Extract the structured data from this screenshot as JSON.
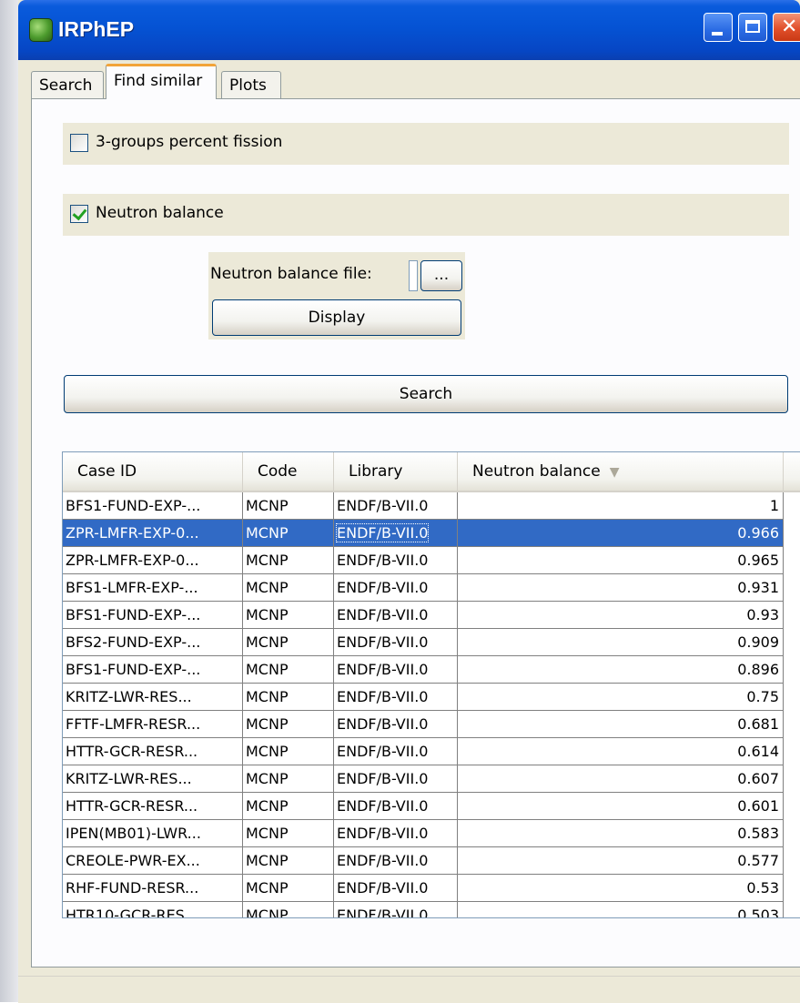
{
  "window": {
    "title": "IRPhEP"
  },
  "tabs": [
    {
      "label": "Search",
      "active": false
    },
    {
      "label": "Find similar",
      "active": true
    },
    {
      "label": "Plots",
      "active": false
    }
  ],
  "options": {
    "percent_fission": {
      "label": "3-groups percent fission",
      "checked": false
    },
    "neutron_balance": {
      "label": "Neutron balance",
      "checked": true
    }
  },
  "neutron_balance_file": {
    "label": "Neutron balance file:",
    "value": "",
    "browse_label": "...",
    "display_label": "Display"
  },
  "search_button_label": "Search",
  "table": {
    "columns": [
      "Case ID",
      "Code",
      "Library",
      "Neutron balance"
    ],
    "sort_column": "Neutron balance",
    "sort_direction": "descending",
    "rows": [
      {
        "case_id": "BFS1-FUND-EXP-...",
        "code": "MCNP",
        "library": "ENDF/B-VII.0",
        "balance": "1",
        "selected": false
      },
      {
        "case_id": "ZPR-LMFR-EXP-0...",
        "code": "MCNP",
        "library": "ENDF/B-VII.0",
        "balance": "0.966",
        "selected": true
      },
      {
        "case_id": "ZPR-LMFR-EXP-0...",
        "code": "MCNP",
        "library": "ENDF/B-VII.0",
        "balance": "0.965",
        "selected": false
      },
      {
        "case_id": "BFS1-LMFR-EXP-...",
        "code": "MCNP",
        "library": "ENDF/B-VII.0",
        "balance": "0.931",
        "selected": false
      },
      {
        "case_id": "BFS1-FUND-EXP-...",
        "code": "MCNP",
        "library": "ENDF/B-VII.0",
        "balance": "0.93",
        "selected": false
      },
      {
        "case_id": "BFS2-FUND-EXP-...",
        "code": "MCNP",
        "library": "ENDF/B-VII.0",
        "balance": "0.909",
        "selected": false
      },
      {
        "case_id": "BFS1-FUND-EXP-...",
        "code": "MCNP",
        "library": "ENDF/B-VII.0",
        "balance": "0.896",
        "selected": false
      },
      {
        "case_id": "KRITZ-LWR-RES...",
        "code": "MCNP",
        "library": "ENDF/B-VII.0",
        "balance": "0.75",
        "selected": false
      },
      {
        "case_id": "FFTF-LMFR-RESR...",
        "code": "MCNP",
        "library": "ENDF/B-VII.0",
        "balance": "0.681",
        "selected": false
      },
      {
        "case_id": "HTTR-GCR-RESR...",
        "code": "MCNP",
        "library": "ENDF/B-VII.0",
        "balance": "0.614",
        "selected": false
      },
      {
        "case_id": "KRITZ-LWR-RES...",
        "code": "MCNP",
        "library": "ENDF/B-VII.0",
        "balance": "0.607",
        "selected": false
      },
      {
        "case_id": "HTTR-GCR-RESR...",
        "code": "MCNP",
        "library": "ENDF/B-VII.0",
        "balance": "0.601",
        "selected": false
      },
      {
        "case_id": "IPEN(MB01)-LWR...",
        "code": "MCNP",
        "library": "ENDF/B-VII.0",
        "balance": "0.583",
        "selected": false
      },
      {
        "case_id": "CREOLE-PWR-EX...",
        "code": "MCNP",
        "library": "ENDF/B-VII.0",
        "balance": "0.577",
        "selected": false
      },
      {
        "case_id": "RHF-FUND-RESR...",
        "code": "MCNP",
        "library": "ENDF/B-VII.0",
        "balance": "0.53",
        "selected": false
      },
      {
        "case_id": "HTR10-GCR-RES...",
        "code": "MCNP",
        "library": "ENDF/B-VII.0",
        "balance": "0.503",
        "selected": false
      }
    ]
  },
  "icons": {
    "app": "green-cube-icon",
    "minimize": "minimize-icon",
    "maximize": "maximize-icon",
    "close": "close-icon",
    "sort": "sort-descending-icon"
  }
}
